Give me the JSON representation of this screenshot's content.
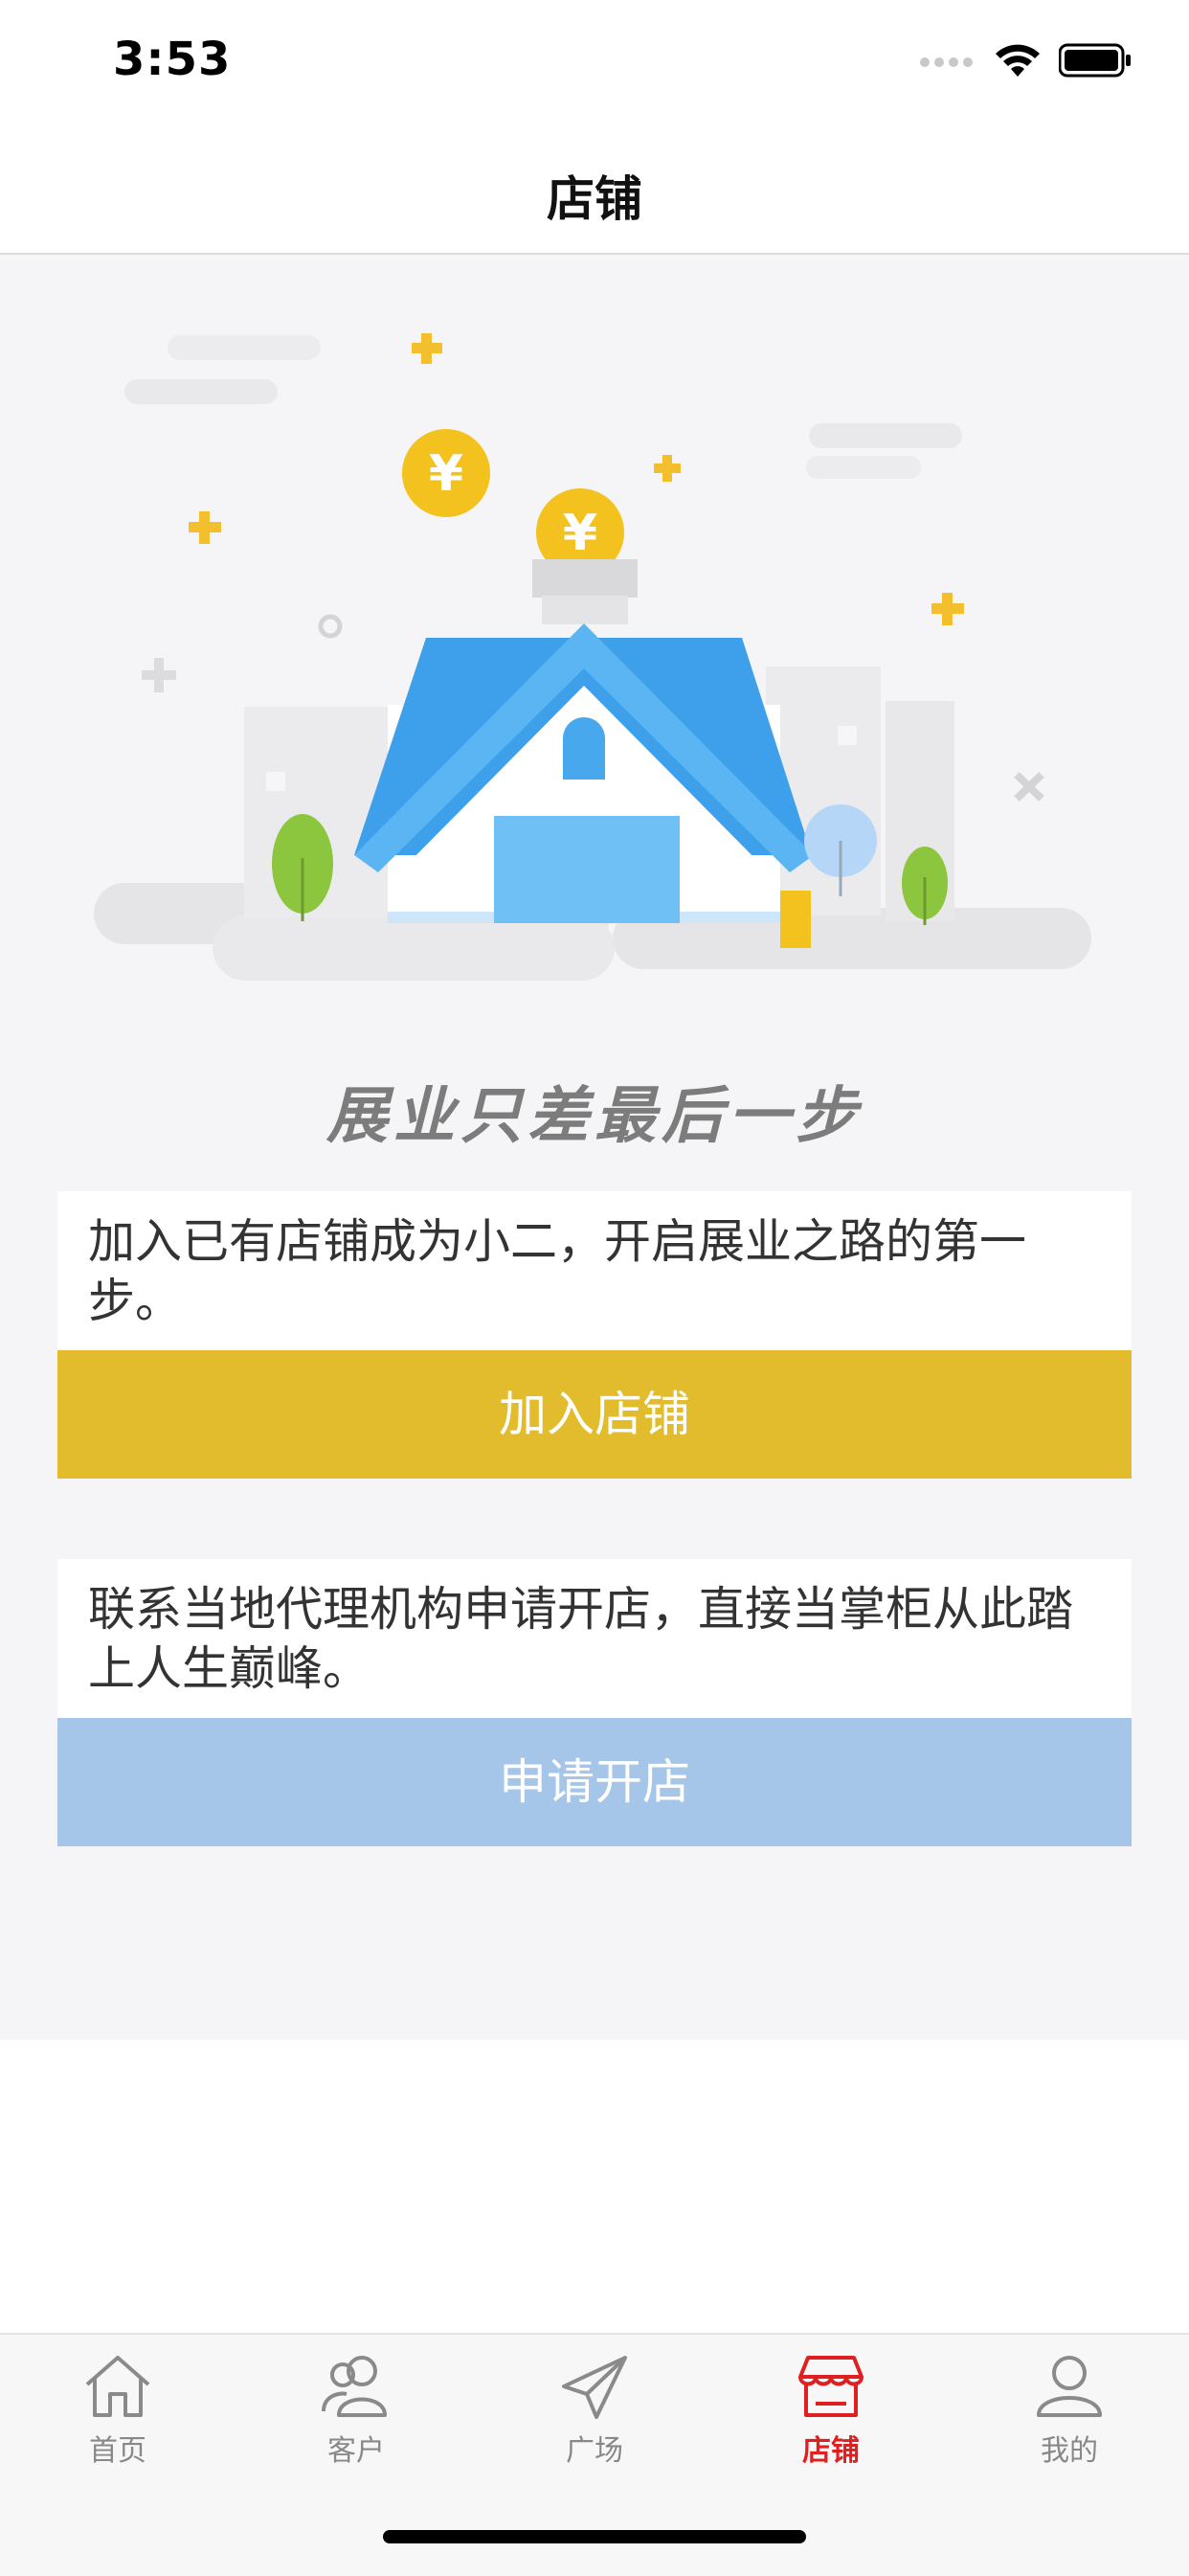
{
  "status_bar": {
    "time": "3:53"
  },
  "nav": {
    "title": "店铺"
  },
  "hero": {
    "slogan": "展业只差最后一步"
  },
  "join_card": {
    "text": "加入已有店铺成为小二，开启展业之路的第一步。",
    "button_label": "加入店铺"
  },
  "apply_card": {
    "text": "联系当地代理机构申请开店，直接当掌柜从此踏上人生巅峰。",
    "button_label": "申请开店"
  },
  "tabs": [
    {
      "label": "首页",
      "icon": "home-icon"
    },
    {
      "label": "客户",
      "icon": "customers-icon"
    },
    {
      "label": "广场",
      "icon": "paper-plane-icon"
    },
    {
      "label": "店铺",
      "icon": "store-icon",
      "active": true
    },
    {
      "label": "我的",
      "icon": "profile-icon"
    }
  ],
  "colors": {
    "accent_red": "#e02020",
    "join_button": "#e2bc2d",
    "apply_button": "#a5c6e8",
    "house_blue": "#3ea0ea"
  }
}
